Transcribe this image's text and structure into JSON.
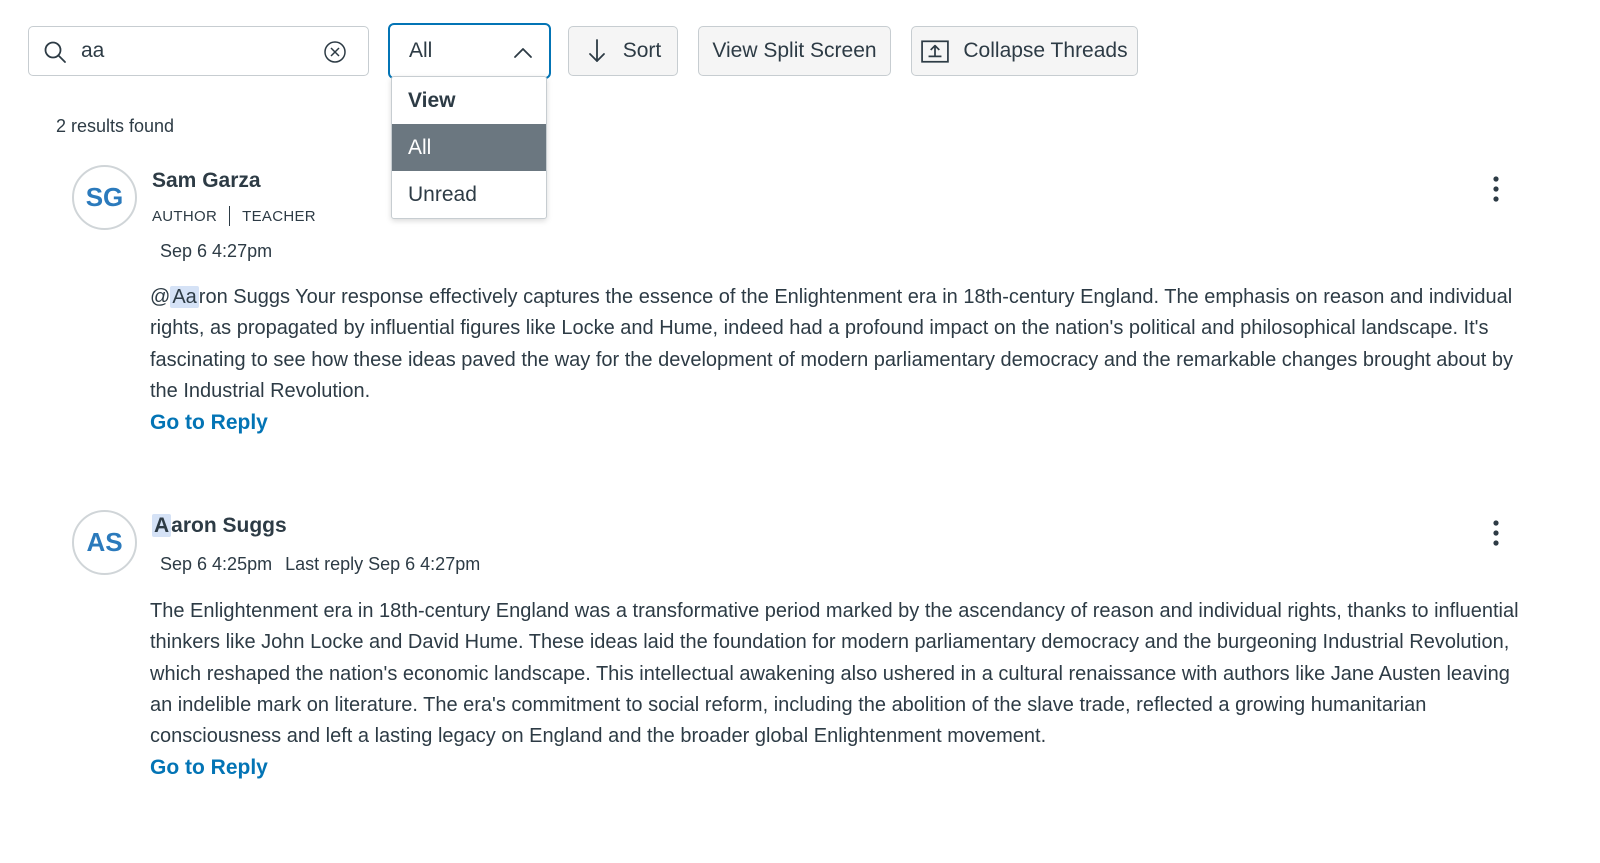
{
  "search": {
    "value": "aa"
  },
  "view_select": {
    "value": "All",
    "header": "View",
    "options": [
      "All",
      "Unread"
    ],
    "selected": "All"
  },
  "toolbar": {
    "sort_label": "Sort",
    "split_label": "View Split Screen",
    "collapse_label": "Collapse Threads"
  },
  "results_count": "2 results found",
  "highlight_term": "Aa",
  "entries": [
    {
      "initials": "SG",
      "author": "Sam Garza",
      "roles": [
        "AUTHOR",
        "TEACHER"
      ],
      "date": "Sep 6 4:27pm",
      "last_reply": "",
      "body_prefix": "@",
      "body_highlight": "Aa",
      "body_rest": "ron Suggs Your response effectively captures the essence of the Enlightenment era in 18th-century England. The emphasis on reason and individual rights, as propagated by influential figures like Locke and Hume, indeed had a profound impact on the nation's political and philosophical landscape. It's fascinating to see how these ideas paved the way for the development of modern parliamentary democracy and the remarkable changes brought about by the Industrial Revolution.",
      "go_reply": "Go to Reply"
    },
    {
      "initials": "AS",
      "author_highlight": "A",
      "author_rest": "aron Suggs",
      "date": "Sep 6 4:25pm",
      "last_reply": "Last reply Sep 6 4:27pm",
      "body": "The Enlightenment era in 18th-century England was a transformative period marked by the ascendancy of reason and individual rights, thanks to influential thinkers like John Locke and David Hume. These ideas laid the foundation for modern parliamentary democracy and the burgeoning Industrial Revolution, which reshaped the nation's economic landscape. This intellectual awakening also ushered in a cultural renaissance with authors like Jane Austen leaving an indelible mark on literature. The era's commitment to social reform, including the abolition of the slave trade, reflected a growing humanitarian consciousness and left a lasting legacy on England and the broader global Enlightenment movement.",
      "go_reply": "Go to Reply"
    }
  ],
  "colors": {
    "accent": "#0374b5",
    "text": "#2d3b45",
    "selected_bg": "#6b7780",
    "highlight": "#d5e2f6",
    "avatar_text": "#2b7abc"
  },
  "icons": {
    "search": "search-icon",
    "clear": "clear-circle-x-icon",
    "chevron": "chevron-up-icon",
    "sort": "arrow-down-icon",
    "collapse": "collapse-upload-icon",
    "more": "more-vertical-icon"
  }
}
